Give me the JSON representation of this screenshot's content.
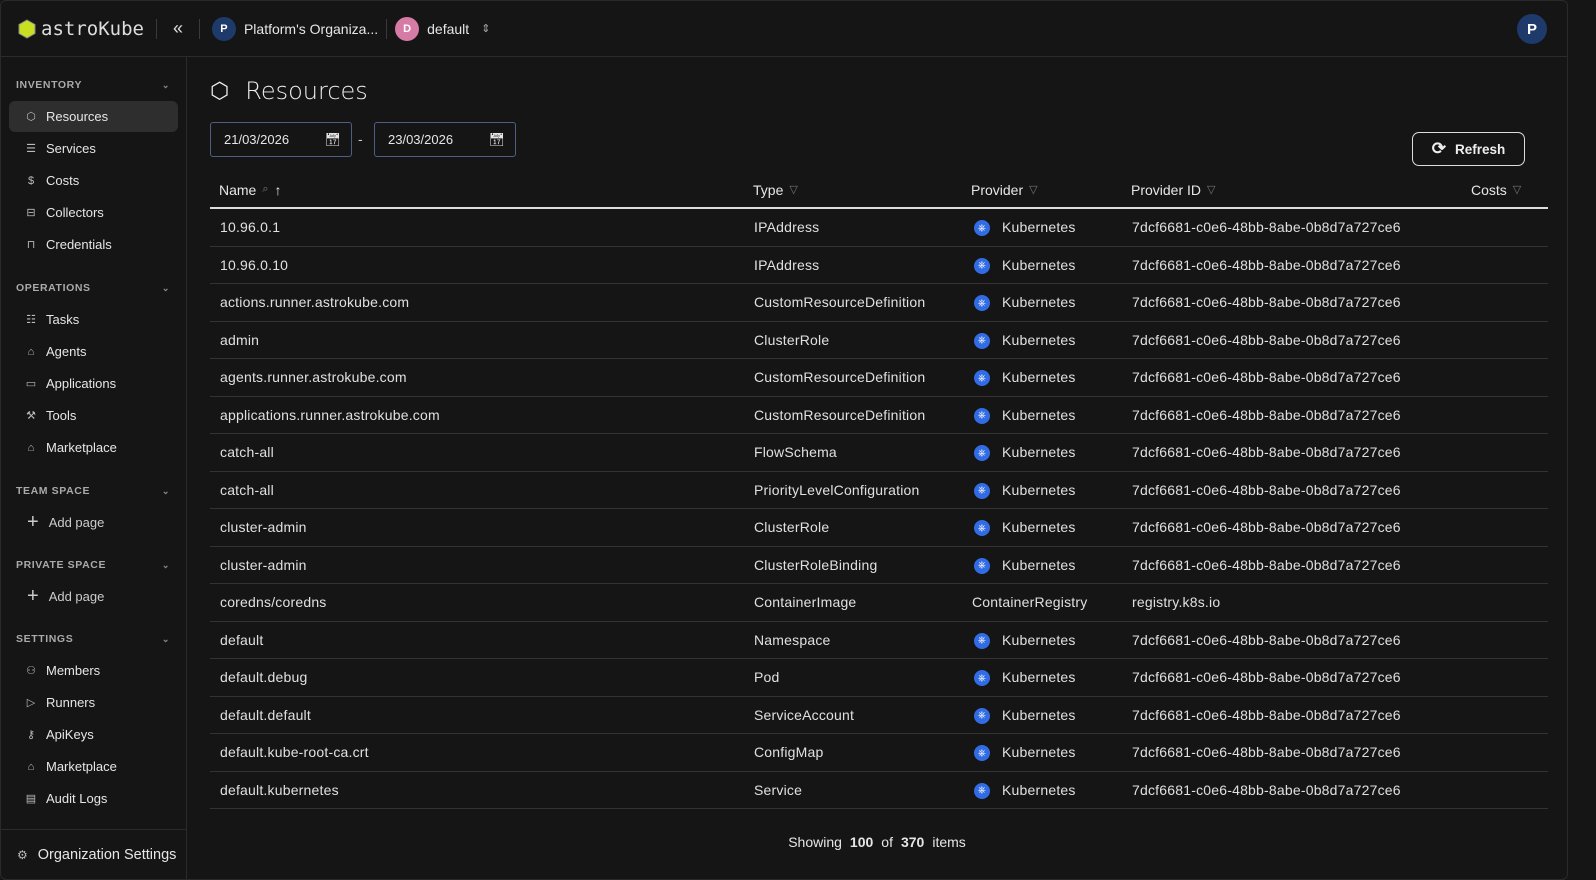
{
  "header": {
    "logo": "astroKube",
    "org": "Platform's Organiza...",
    "org_initial": "P",
    "project": "default",
    "project_initial": "D",
    "user_initial": "P"
  },
  "sidebar": {
    "inventory": {
      "label": "INVENTORY",
      "items": [
        {
          "label": "Resources",
          "icon": "hexagon-icon"
        },
        {
          "label": "Services",
          "icon": "server-icon"
        },
        {
          "label": "Costs",
          "icon": "dollar-icon"
        },
        {
          "label": "Collectors",
          "icon": "collector-icon"
        },
        {
          "label": "Credentials",
          "icon": "lock-icon"
        }
      ]
    },
    "operations": {
      "label": "OPERATIONS",
      "items": [
        {
          "label": "Tasks",
          "icon": "list-icon"
        },
        {
          "label": "Agents",
          "icon": "bot-icon"
        },
        {
          "label": "Applications",
          "icon": "window-icon"
        },
        {
          "label": "Tools",
          "icon": "tool-icon"
        },
        {
          "label": "Marketplace",
          "icon": "store-icon"
        }
      ]
    },
    "team_space": {
      "label": "TEAM SPACE",
      "add": "Add page"
    },
    "private_space": {
      "label": "PRIVATE SPACE",
      "add": "Add page"
    },
    "settings": {
      "label": "SETTINGS",
      "items": [
        {
          "label": "Members",
          "icon": "users-icon"
        },
        {
          "label": "Runners",
          "icon": "play-icon"
        },
        {
          "label": "ApiKeys",
          "icon": "key-icon"
        },
        {
          "label": "Marketplace",
          "icon": "store-icon"
        },
        {
          "label": "Audit Logs",
          "icon": "clipboard-icon"
        }
      ]
    },
    "org_settings": "Organization Settings"
  },
  "main": {
    "title": "Resources",
    "date_from": "21/03/2026",
    "date_to": "23/03/2026",
    "refresh": "Refresh",
    "columns": {
      "name": "Name",
      "type": "Type",
      "provider": "Provider",
      "provider_id": "Provider ID",
      "costs": "Costs"
    },
    "rows": [
      [
        "10.96.0.1",
        "IPAddress",
        "Kubernetes",
        "7dcf6681-c0e6-48bb-8abe-0b8d7a727ce6"
      ],
      [
        "10.96.0.10",
        "IPAddress",
        "Kubernetes",
        "7dcf6681-c0e6-48bb-8abe-0b8d7a727ce6"
      ],
      [
        "actions.runner.astrokube.com",
        "CustomResourceDefinition",
        "Kubernetes",
        "7dcf6681-c0e6-48bb-8abe-0b8d7a727ce6"
      ],
      [
        "admin",
        "ClusterRole",
        "Kubernetes",
        "7dcf6681-c0e6-48bb-8abe-0b8d7a727ce6"
      ],
      [
        "agents.runner.astrokube.com",
        "CustomResourceDefinition",
        "Kubernetes",
        "7dcf6681-c0e6-48bb-8abe-0b8d7a727ce6"
      ],
      [
        "applications.runner.astrokube.com",
        "CustomResourceDefinition",
        "Kubernetes",
        "7dcf6681-c0e6-48bb-8abe-0b8d7a727ce6"
      ],
      [
        "catch-all",
        "FlowSchema",
        "Kubernetes",
        "7dcf6681-c0e6-48bb-8abe-0b8d7a727ce6"
      ],
      [
        "catch-all",
        "PriorityLevelConfiguration",
        "Kubernetes",
        "7dcf6681-c0e6-48bb-8abe-0b8d7a727ce6"
      ],
      [
        "cluster-admin",
        "ClusterRole",
        "Kubernetes",
        "7dcf6681-c0e6-48bb-8abe-0b8d7a727ce6"
      ],
      [
        "cluster-admin",
        "ClusterRoleBinding",
        "Kubernetes",
        "7dcf6681-c0e6-48bb-8abe-0b8d7a727ce6"
      ],
      [
        "coredns/coredns",
        "ContainerImage",
        "ContainerRegistry",
        "registry.k8s.io"
      ],
      [
        "default",
        "Namespace",
        "Kubernetes",
        "7dcf6681-c0e6-48bb-8abe-0b8d7a727ce6"
      ],
      [
        "default.debug",
        "Pod",
        "Kubernetes",
        "7dcf6681-c0e6-48bb-8abe-0b8d7a727ce6"
      ],
      [
        "default.default",
        "ServiceAccount",
        "Kubernetes",
        "7dcf6681-c0e6-48bb-8abe-0b8d7a727ce6"
      ],
      [
        "default.kube-root-ca.crt",
        "ConfigMap",
        "Kubernetes",
        "7dcf6681-c0e6-48bb-8abe-0b8d7a727ce6"
      ],
      [
        "default.kubernetes",
        "Service",
        "Kubernetes",
        "7dcf6681-c0e6-48bb-8abe-0b8d7a727ce6"
      ]
    ],
    "footer": {
      "showing": "Showing",
      "count": "100",
      "of": "of",
      "total": "370",
      "items": "items"
    }
  },
  "colors": {
    "accent": "#c8e021",
    "kubernetes": "#326ce5",
    "date_border": "#4d5f85"
  }
}
